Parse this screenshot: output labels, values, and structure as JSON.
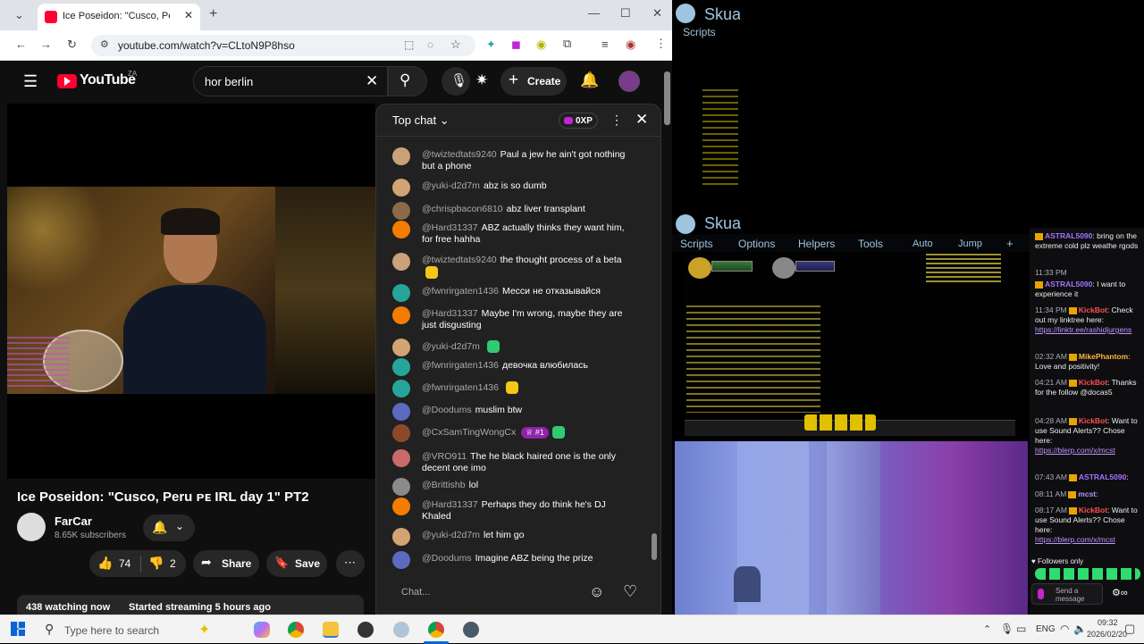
{
  "browser": {
    "tab_title": "Ice Poseidon: \"Cusco, Peru",
    "url": "youtube.com/watch?v=CLtoN9P8hso"
  },
  "youtube": {
    "logo_text": "YouTube",
    "country_code": "ZA",
    "search_value": "hor berlin",
    "create_label": "Create"
  },
  "video": {
    "title": "Ice Poseidon: \"Cusco, Peru ᴘᴇ IRL day 1\" PT2",
    "channel_name": "FarCar",
    "subscribers": "8.65K subscribers",
    "likes": "74",
    "dislikes": "2",
    "share_label": "Share",
    "save_label": "Save",
    "watching": "438 watching now",
    "started": "Started streaming 5 hours ago"
  },
  "chat": {
    "header": "Top chat",
    "xp": "0XP",
    "placeholder": "Chat...",
    "messages": [
      {
        "author": "@twiztedtats9240",
        "text": "Paul a jew he ain't got nothing but a phone",
        "color": "#c9a27a"
      },
      {
        "author": "@yuki-d2d7m",
        "text": "abz is so dumb",
        "color": "#d4a373"
      },
      {
        "author": "@chrispbacon6810",
        "text": "abz liver transplant",
        "color": "#8a6a4a"
      },
      {
        "author": "@Hard31337",
        "text": "ABZ actually thinks they want him, for free hahha",
        "color": "#f57c00"
      },
      {
        "author": "@twiztedtats9240",
        "text": "the thought process of a beta",
        "color": "#c9a27a"
      },
      {
        "author": "@fwnrirgaten1436",
        "text": "Месси не отказывайся",
        "color": "#26a69a"
      },
      {
        "author": "@Hard31337",
        "text": "Maybe I'm wrong, maybe they are just disgusting",
        "color": "#f57c00"
      },
      {
        "author": "@yuki-d2d7m",
        "text": "",
        "color": "#d4a373"
      },
      {
        "author": "@fwnrirgaten1436",
        "text": "девочка влюбилась",
        "color": "#26a69a"
      },
      {
        "author": "@fwnrirgaten1436",
        "text": "",
        "color": "#26a69a"
      },
      {
        "author": "@Doodums",
        "text": "muslim btw",
        "color": "#5c6bc0"
      },
      {
        "author": "@CxSamTingWongCx",
        "text": "",
        "color": "#8a4a2a"
      },
      {
        "author": "@VRO911",
        "text": "The he black haired one is the only decent one imo",
        "color": "#c96a6a"
      },
      {
        "author": "@Brittishb",
        "text": "lol",
        "color": "#8a8a8a"
      },
      {
        "author": "@Hard31337",
        "text": "Perhaps they do think he's DJ Khaled",
        "color": "#f57c00"
      },
      {
        "author": "@yuki-d2d7m",
        "text": "let him go",
        "color": "#d4a373"
      },
      {
        "author": "@Doodums",
        "text": "Imagine ABZ being the prize",
        "color": "#5c6bc0"
      }
    ],
    "badge_rank": "#1"
  },
  "skua": {
    "title": "Skua",
    "scripts": "Scripts",
    "menu": [
      "Scripts",
      "Options",
      "Helpers",
      "Tools",
      "Auto",
      "Jump",
      "+"
    ]
  },
  "twitch": {
    "messages": [
      {
        "time": "",
        "user": "ASTRAL5090",
        "text": ": bring on the extreme cold plz weathe rgods",
        "ucolor": "#a970ff"
      },
      {
        "time": "11:33 PM",
        "user": "",
        "text": "",
        "ucolor": "#a970ff"
      },
      {
        "time": "",
        "user": "ASTRAL5090",
        "text": ": I want to experience it",
        "ucolor": "#a970ff"
      },
      {
        "time": "11:34 PM",
        "user": "KickBot",
        "text": ": Check out my linktree here:",
        "link": "https://linktr.ee/rashidjurgens",
        "ucolor": "#ff4f4f"
      },
      {
        "time": "02:32 AM",
        "user": "MikePhantom",
        "text": ": Love and positivity!",
        "ucolor": "#ffb347"
      },
      {
        "time": "04:21 AM",
        "user": "KickBot",
        "text": ": Thanks for the follow @docas5",
        "ucolor": "#ff4f4f"
      },
      {
        "time": "04:28 AM",
        "user": "KickBot",
        "text": ": Want to use Sound Alerts?? Chose here:",
        "link": "https://blerp.com/x/mcst",
        "ucolor": "#ff4f4f"
      },
      {
        "time": "07:43 AM",
        "user": "ASTRAL5090",
        "text": ":",
        "ucolor": "#a970ff"
      },
      {
        "time": "08:11 AM",
        "user": "mcst",
        "text": ":",
        "ucolor": "#bf94ff"
      },
      {
        "time": "08:17 AM",
        "user": "KickBot",
        "text": ": Want to use Sound Alerts?? Chose here:",
        "link": "https://blerp.com/x/mcst",
        "ucolor": "#ff4f4f"
      }
    ],
    "followers_only": "Followers only",
    "send_placeholder": "Send a message"
  },
  "taskbar": {
    "search_placeholder": "Type here to search",
    "lang": "ENG",
    "time": "09:32",
    "date": "2026/02/20"
  }
}
